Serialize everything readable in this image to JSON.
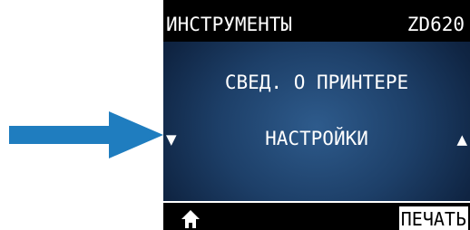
{
  "screen": {
    "header": {
      "title": "ИНСТРУМЕНТЫ",
      "model": "ZD620"
    },
    "menu": {
      "items": [
        {
          "label": "СВЕД. О ПРИНТЕРЕ"
        },
        {
          "label": "НАСТРОЙКИ",
          "selected": true
        }
      ],
      "nav_down": "▼",
      "nav_up": "▲"
    },
    "footer": {
      "home_icon": "home-icon",
      "print_label": "ПЕЧАТЬ"
    }
  },
  "annotation": {
    "pointer_icon": "arrow-right-icon",
    "pointer_color": "#1f7dbf"
  }
}
